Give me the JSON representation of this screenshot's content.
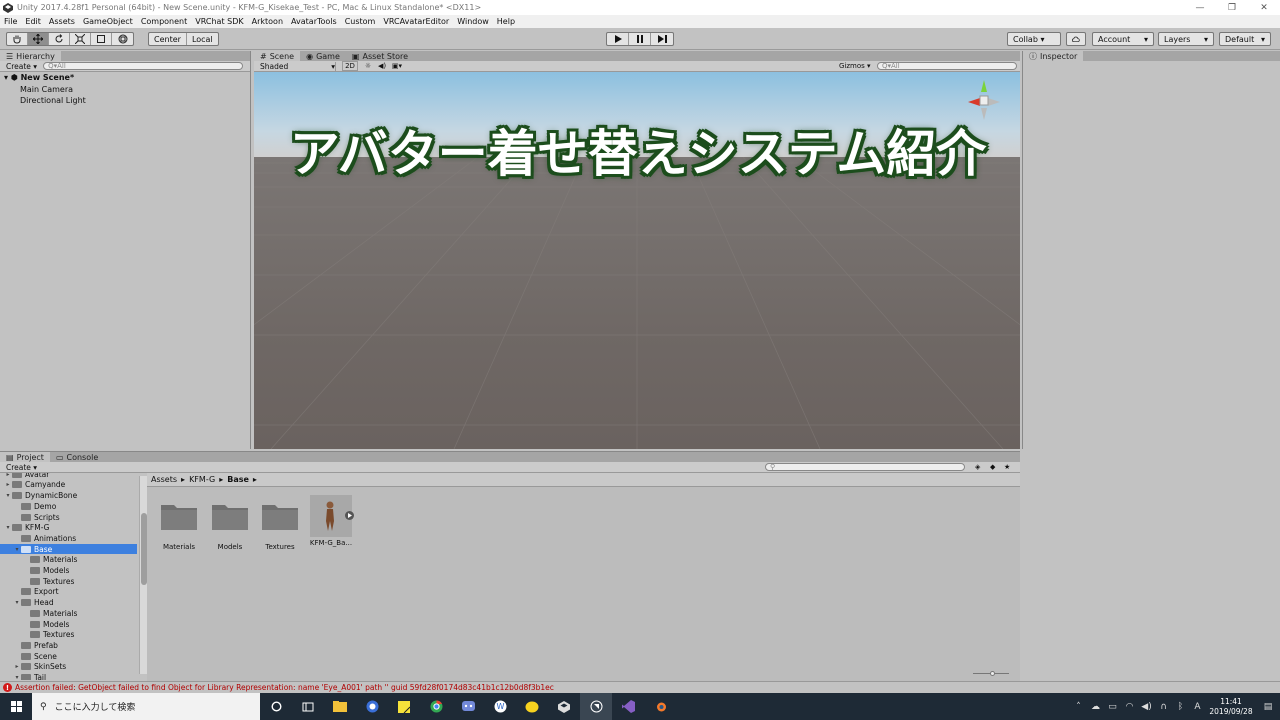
{
  "window": {
    "title": "Unity 2017.4.28f1 Personal (64bit) - New Scene.unity - KFM-G_Kisekae_Test - PC, Mac & Linux Standalone* <DX11>",
    "controls": [
      "—",
      "❐",
      "✕"
    ]
  },
  "menu": [
    "File",
    "Edit",
    "Assets",
    "GameObject",
    "Component",
    "VRChat SDK",
    "Arktoon",
    "AvatarTools",
    "Custom",
    "VRCAvatarEditor",
    "Window",
    "Help"
  ],
  "toolbar": {
    "pivot": "Center",
    "space": "Local",
    "collab": "Collab ▾",
    "account": "Account",
    "layers": "Layers",
    "layout": "Default"
  },
  "hierarchy": {
    "tab": "Hierarchy",
    "create": "Create ▾",
    "search_placeholder": "Q▾All",
    "scene": "New Scene*",
    "items": [
      "Main Camera",
      "Directional Light"
    ]
  },
  "scene": {
    "tabs": [
      "Scene",
      "Game",
      "Asset Store"
    ],
    "shading": "Shaded",
    "mode2d": "2D",
    "gizmos": "Gizmos ▾",
    "search_placeholder": "Q▾All",
    "overlay_title": "アバター着せ替えシステム紹介"
  },
  "inspector": {
    "tab": "Inspector"
  },
  "project": {
    "tabs": [
      "Project",
      "Console"
    ],
    "create": "Create ▾",
    "tree": [
      {
        "label": "Avatar",
        "depth": 1,
        "arrow": "▸"
      },
      {
        "label": "Camyande",
        "depth": 1,
        "arrow": "▸"
      },
      {
        "label": "DynamicBone",
        "depth": 1,
        "arrow": "▾"
      },
      {
        "label": "Demo",
        "depth": 2,
        "arrow": ""
      },
      {
        "label": "Scripts",
        "depth": 2,
        "arrow": ""
      },
      {
        "label": "KFM-G",
        "depth": 1,
        "arrow": "▾"
      },
      {
        "label": "Animations",
        "depth": 2,
        "arrow": ""
      },
      {
        "label": "Base",
        "depth": 2,
        "arrow": "▾",
        "selected": true
      },
      {
        "label": "Materials",
        "depth": 3,
        "arrow": ""
      },
      {
        "label": "Models",
        "depth": 3,
        "arrow": ""
      },
      {
        "label": "Textures",
        "depth": 3,
        "arrow": ""
      },
      {
        "label": "Export",
        "depth": 2,
        "arrow": ""
      },
      {
        "label": "Head",
        "depth": 2,
        "arrow": "▾"
      },
      {
        "label": "Materials",
        "depth": 3,
        "arrow": ""
      },
      {
        "label": "Models",
        "depth": 3,
        "arrow": ""
      },
      {
        "label": "Textures",
        "depth": 3,
        "arrow": ""
      },
      {
        "label": "Prefab",
        "depth": 2,
        "arrow": ""
      },
      {
        "label": "Scene",
        "depth": 2,
        "arrow": ""
      },
      {
        "label": "SkinSets",
        "depth": 2,
        "arrow": "▸"
      },
      {
        "label": "Tail",
        "depth": 2,
        "arrow": "▾"
      }
    ],
    "breadcrumb": [
      "Assets",
      "KFM-G",
      "Base"
    ],
    "assets": [
      {
        "label": "Materials",
        "kind": "folder"
      },
      {
        "label": "Models",
        "kind": "folder"
      },
      {
        "label": "Textures",
        "kind": "folder"
      },
      {
        "label": "KFM-G_Ba...",
        "kind": "model"
      }
    ]
  },
  "status": {
    "message": "Assertion failed: GetObject failed to find Object for Library Representation: name 'Eye_A001' path '' guid 59fd28f0174d83c41b1c12b0d8f3b1ec"
  },
  "taskbar": {
    "search_placeholder": "ここに入力して検索",
    "time": "11:41",
    "date": "2019/09/28"
  },
  "colors": {
    "selection": "#3d80df",
    "title_outline": "#1c4d1c",
    "error": "#d21a1a"
  }
}
